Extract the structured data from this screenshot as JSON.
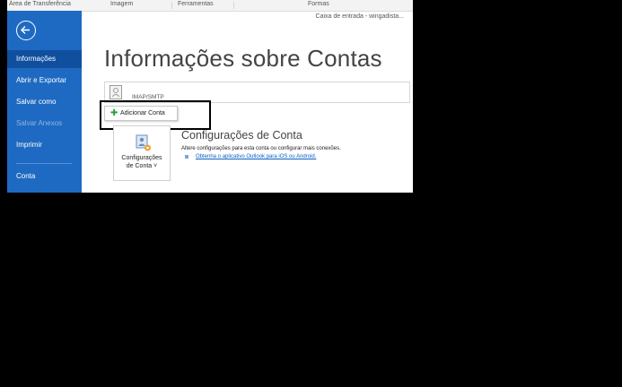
{
  "ribbon": {
    "groups": [
      "Área de Transferência",
      "Imagem",
      "Ferramentas",
      "Formas"
    ]
  },
  "mailbox": {
    "label": "Caixa de entrada - wingadista..."
  },
  "sidebar": {
    "items": [
      {
        "label": "Informações"
      },
      {
        "label": "Abrir e Exportar"
      },
      {
        "label": "Salvar como"
      },
      {
        "label": "Salvar Anexos"
      },
      {
        "label": "Imprimir"
      },
      {
        "label": "Conta"
      }
    ]
  },
  "page": {
    "title": "Informações sobre Contas",
    "account_type": "IMAP/SMTP",
    "add_account_label": "Adicionar Conta",
    "settings_button": {
      "line1": "Configurações",
      "line2": "de Conta ˅"
    },
    "section": {
      "title": "Configurações de Conta",
      "description": "Altere configurações para esta conta ou configurar mais conexões.",
      "link": "Obtenha o aplicativo Outlook para iOS ou Android."
    }
  },
  "colors": {
    "sidebar": "#1e6ac2",
    "sidebar_active": "#0f4f9e",
    "link": "#0b5fc1",
    "add_icon": "#2a9d3f"
  },
  "icons": [
    "back-arrow-icon",
    "account-icon",
    "plus-icon",
    "account-settings-icon",
    "bullet-icon"
  ]
}
